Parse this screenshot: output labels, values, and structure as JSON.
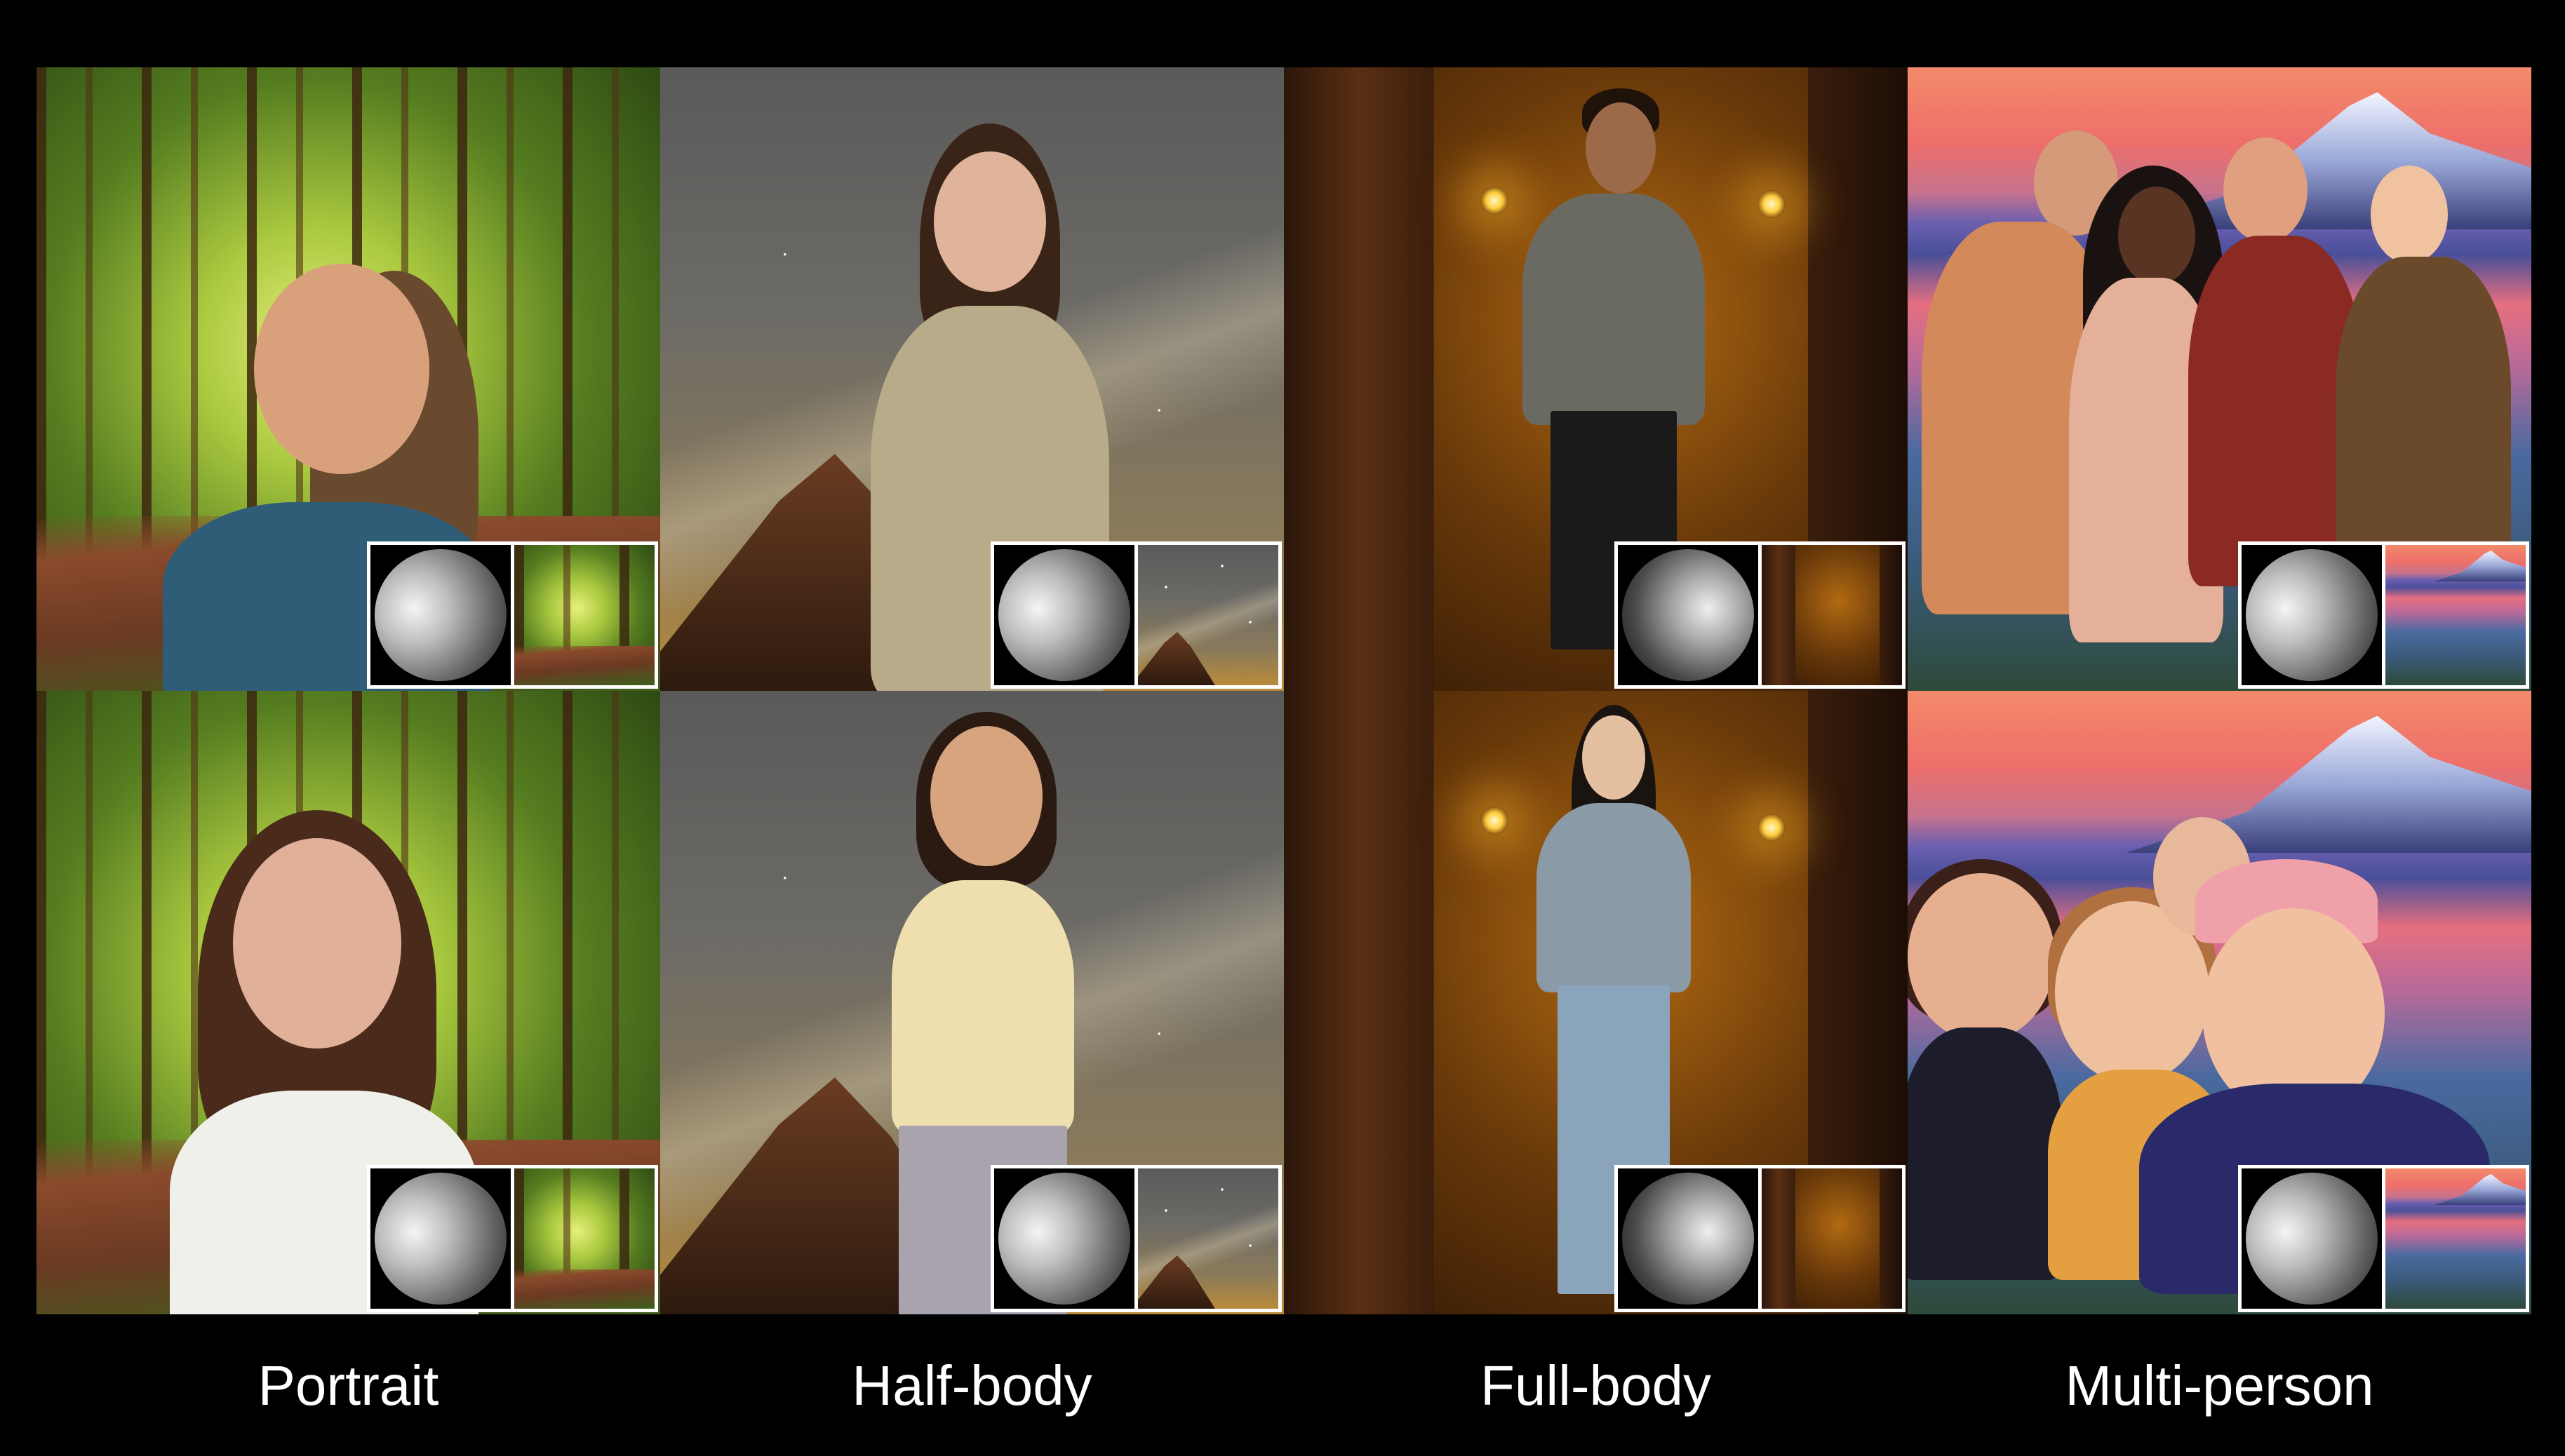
{
  "columns": [
    {
      "caption": "Portrait"
    },
    {
      "caption": "Half-body"
    },
    {
      "caption": "Full-body"
    },
    {
      "caption": "Multi-person"
    }
  ],
  "icons": {
    "sphere": "shaded-sphere-lighting-probe",
    "environment": "environment-map-thumbnail"
  },
  "colors": {
    "background": "#000000",
    "caption": "#ffffff",
    "inset_border": "#ffffff"
  }
}
